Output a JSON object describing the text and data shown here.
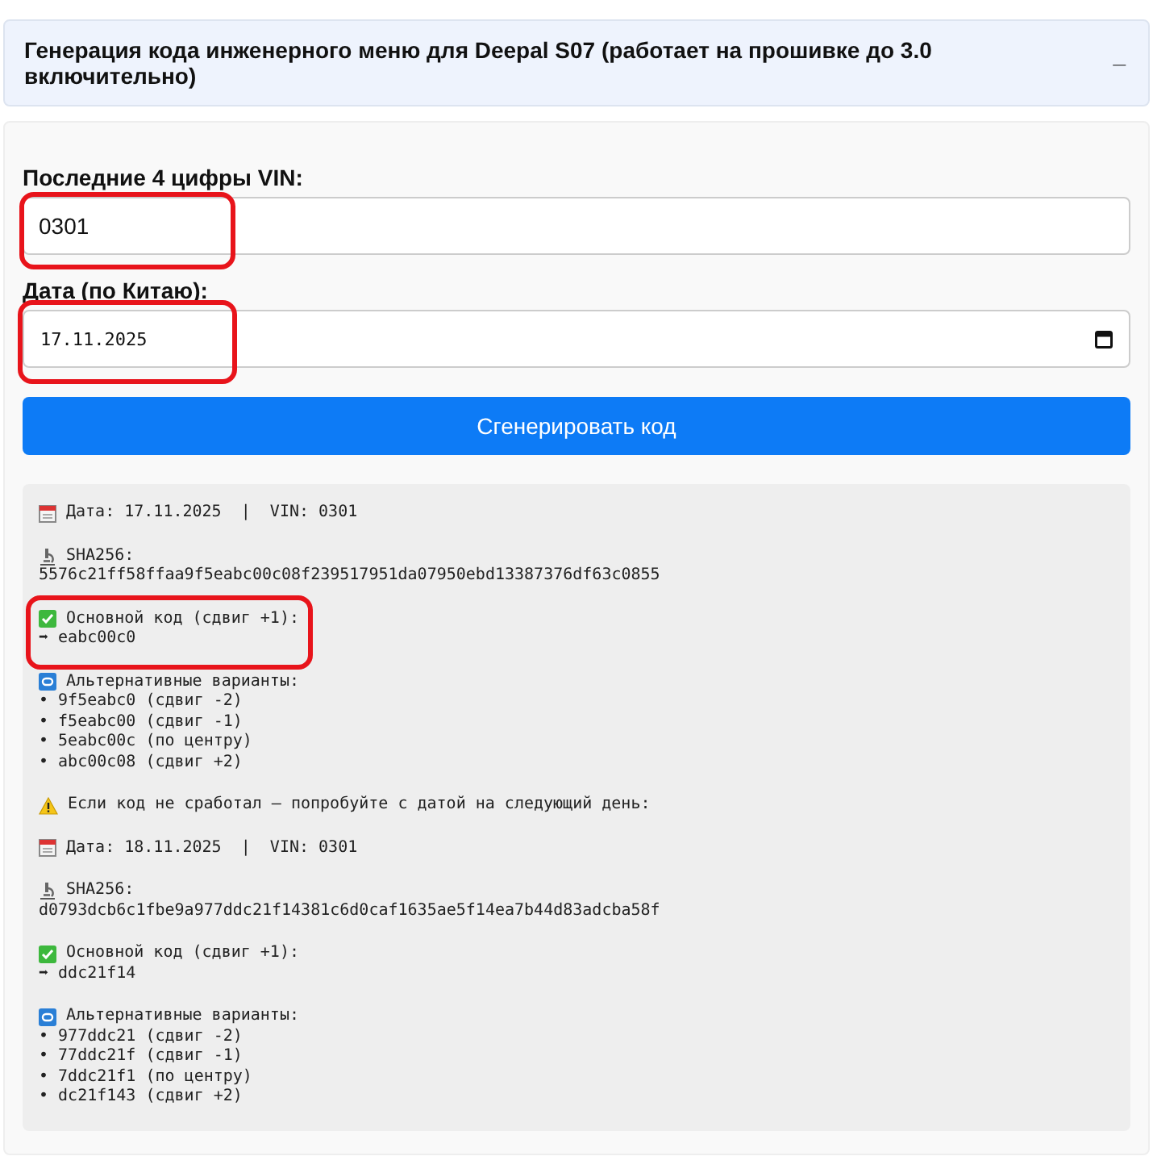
{
  "header": {
    "title": "Генерация кода инженерного меню для Deepal S07 (работает на прошивке до 3.0 включительно)",
    "toggle": "_",
    "expanded": true
  },
  "form": {
    "vin_label": "Последние 4 цифры VIN:",
    "vin_value": "0301",
    "vin_highlighted": true,
    "date_label": "Дата (по Китаю):",
    "date_value": "17.11.2025",
    "date_highlighted": true,
    "button": "Сгенерировать код"
  },
  "result": {
    "blocks": [
      {
        "kind": "date",
        "highlighted": false,
        "lines": [
          "Дата: 17.11.2025  |  VIN: 0301"
        ]
      },
      {
        "kind": "sha",
        "highlighted": false,
        "lines": [
          "SHA256:",
          "5576c21ff58ffaa9f5eabc00c08f239517951da07950ebd13387376df63c0855"
        ]
      },
      {
        "kind": "main",
        "highlighted": true,
        "lines": [
          "Основной код (сдвиг +1):",
          "➡ eabc00c0"
        ]
      },
      {
        "kind": "alt",
        "highlighted": false,
        "lines": [
          "Альтернативные варианты:",
          "• 9f5eabc0 (сдвиг -2)",
          "• f5eabc00 (сдвиг -1)",
          "• 5eabc00c (по центру)",
          "• abc00c08 (сдвиг +2)"
        ]
      },
      {
        "kind": "warning",
        "highlighted": false,
        "lines": [
          "Если код не сработал — попробуйте с датой на следующий день:"
        ]
      },
      {
        "kind": "date",
        "highlighted": false,
        "lines": [
          "Дата: 18.11.2025  |  VIN: 0301"
        ]
      },
      {
        "kind": "sha",
        "highlighted": false,
        "lines": [
          "SHA256:",
          "d0793dcb6c1fbe9a977ddc21f14381c6d0caf1635ae5f14ea7b44d83adcba58f"
        ]
      },
      {
        "kind": "main",
        "highlighted": false,
        "lines": [
          "Основной код (сдвиг +1):",
          "➡ ddc21f14"
        ]
      },
      {
        "kind": "alt",
        "highlighted": false,
        "lines": [
          "Альтернативные варианты:",
          "• 977ddc21 (сдвиг -2)",
          "• 77ddc21f (сдвиг -1)",
          "• 7ddc21f1 (по центру)",
          "• dc21f143 (сдвиг +2)"
        ]
      }
    ]
  }
}
